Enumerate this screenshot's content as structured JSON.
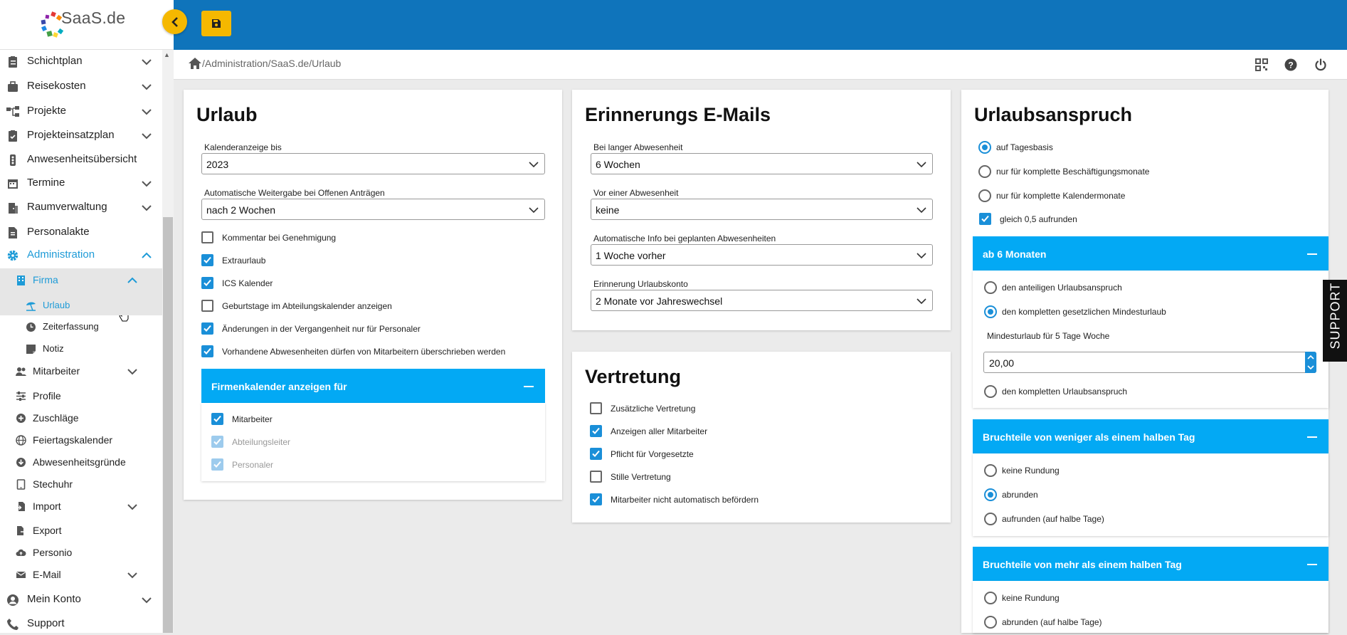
{
  "app": {
    "logo_text": "SaaS.de"
  },
  "breadcrumb": "/Administration/SaaS.de/Urlaub",
  "sidebar": {
    "items": [
      {
        "label": "Schichtplan"
      },
      {
        "label": "Reisekosten"
      },
      {
        "label": "Projekte"
      },
      {
        "label": "Projekteinsatzplan"
      },
      {
        "label": "Anwesenheitsübersicht"
      },
      {
        "label": "Termine"
      },
      {
        "label": "Raumverwaltung"
      },
      {
        "label": "Personalakte"
      },
      {
        "label": "Administration"
      },
      {
        "label": "Firma"
      },
      {
        "label": "Urlaub"
      },
      {
        "label": "Zeiterfassung"
      },
      {
        "label": "Notiz"
      },
      {
        "label": "Mitarbeiter"
      },
      {
        "label": "Profile"
      },
      {
        "label": "Zuschläge"
      },
      {
        "label": "Feiertagskalender"
      },
      {
        "label": "Abwesenheitsgründe"
      },
      {
        "label": "Stechuhr"
      },
      {
        "label": "Import"
      },
      {
        "label": "Export"
      },
      {
        "label": "Personio"
      },
      {
        "label": "E-Mail"
      },
      {
        "label": "Mein Konto"
      },
      {
        "label": "Support"
      }
    ]
  },
  "urlaub": {
    "title": "Urlaub",
    "kalender_label": "Kalenderanzeige bis",
    "kalender_value": "2023",
    "weitergabe_label": "Automatische Weitergabe bei Offenen Anträgen",
    "weitergabe_value": "nach 2 Wochen",
    "checkboxes": [
      {
        "label": "Kommentar bei Genehmigung",
        "checked": false
      },
      {
        "label": "Extraurlaub",
        "checked": true
      },
      {
        "label": "ICS Kalender",
        "checked": true
      },
      {
        "label": "Geburtstage im Abteilungskalender anzeigen",
        "checked": false
      },
      {
        "label": "Änderungen in der Vergangenheit nur für Personaler",
        "checked": true
      },
      {
        "label": "Vorhandene Abwesenheiten dürfen von Mitarbeitern überschrieben werden",
        "checked": true
      }
    ],
    "panel_title": "Firmenkalender anzeigen für",
    "panel_items": [
      {
        "label": "Mitarbeiter",
        "checked": true,
        "disabled": false
      },
      {
        "label": "Abteilungsleiter",
        "checked": true,
        "disabled": true
      },
      {
        "label": "Personaler",
        "checked": true,
        "disabled": true
      }
    ]
  },
  "erinnerung": {
    "title": "Erinnerungs E-Mails",
    "fields": [
      {
        "label": "Bei langer Abwesenheit",
        "value": "6 Wochen"
      },
      {
        "label": "Vor einer Abwesenheit",
        "value": "keine"
      },
      {
        "label": "Automatische Info bei geplanten Abwesenheiten",
        "value": "1 Woche vorher"
      },
      {
        "label": "Erinnerung Urlaubskonto",
        "value": "2 Monate vor Jahreswechsel"
      }
    ]
  },
  "vertretung": {
    "title": "Vertretung",
    "checkboxes": [
      {
        "label": "Zusätzliche Vertretung",
        "checked": false
      },
      {
        "label": "Anzeigen aller Mitarbeiter",
        "checked": true
      },
      {
        "label": "Pflicht für Vorgesetzte",
        "checked": true
      },
      {
        "label": "Stille Vertretung",
        "checked": false
      },
      {
        "label": "Mitarbeiter nicht automatisch befördern",
        "checked": true
      }
    ]
  },
  "anspruch": {
    "title": "Urlaubsanspruch",
    "radios": [
      {
        "label": "auf Tagesbasis",
        "selected": true
      },
      {
        "label": "nur für komplette Beschäftigungsmonate",
        "selected": false
      },
      {
        "label": "nur für komplette Kalendermonate",
        "selected": false
      }
    ],
    "round_checkbox": {
      "label": "gleich 0,5 aufrunden",
      "checked": true
    },
    "panel1": {
      "title": "ab 6 Monaten",
      "radio1": "den anteiligen Urlaubsanspruch",
      "radio2": "den kompletten gesetzlichen Mindesturlaub",
      "selected": 2,
      "min_label": "Mindesturlaub für 5 Tage Woche",
      "min_value": "20,00",
      "radio3": "den kompletten Urlaubsanspruch"
    },
    "panel2": {
      "title": "Bruchteile von weniger als einem halben Tag",
      "radios": [
        {
          "label": "keine Rundung",
          "selected": false
        },
        {
          "label": "abrunden",
          "selected": true
        },
        {
          "label": "aufrunden (auf halbe Tage)",
          "selected": false
        }
      ]
    },
    "panel3": {
      "title": "Bruchteile von mehr als einem halben Tag",
      "radios": [
        {
          "label": "keine Rundung",
          "selected": false
        },
        {
          "label": "abrunden (auf halbe Tage)",
          "selected": false
        }
      ]
    }
  },
  "support_tab": "SUPPORT",
  "colors": {
    "topbar": "#0f74bb",
    "accent": "#03a9f4",
    "button": "#f5b800",
    "checkbox": "#1a8fd8"
  }
}
